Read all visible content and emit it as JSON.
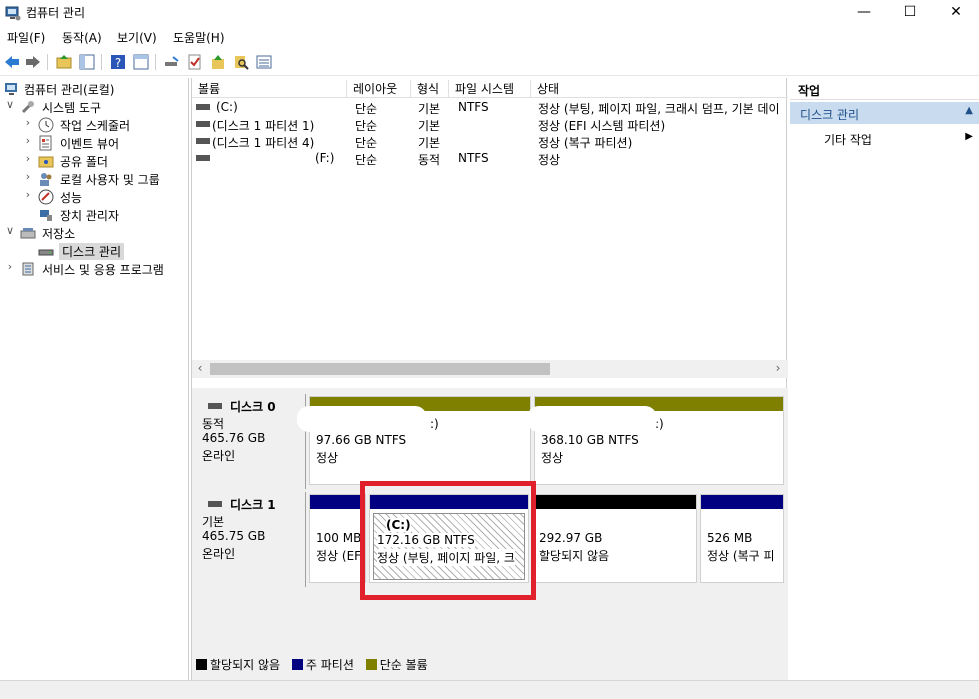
{
  "window": {
    "title": "컴퓨터 관리",
    "minimize": "—",
    "maximize": "☐",
    "close": "✕"
  },
  "menu": [
    "파일(F)",
    "동작(A)",
    "보기(V)",
    "도움말(H)"
  ],
  "tree": {
    "root": "컴퓨터 관리(로컬)",
    "system_tools": "시스템 도구",
    "task_scheduler": "작업 스케줄러",
    "event_viewer": "이벤트 뷰어",
    "shared_folders": "공유 폴더",
    "local_users": "로컬 사용자 및 그룹",
    "performance": "성능",
    "device_manager": "장치 관리자",
    "storage": "저장소",
    "disk_management": "디스크 관리",
    "services": "서비스 및 응용 프로그램"
  },
  "volume_table": {
    "columns": [
      "볼륨",
      "레이아웃",
      "형식",
      "파일 시스템",
      "상태"
    ],
    "rows": [
      {
        "volume": "(C:)",
        "layout": "단순",
        "type": "기본",
        "fs": "NTFS",
        "status": "정상 (부팅, 페이지 파일, 크래시 덤프, 기본 데이"
      },
      {
        "volume": "(디스크 1 파티션 1)",
        "layout": "단순",
        "type": "기본",
        "fs": "",
        "status": "정상 (EFI 시스템 파티션)"
      },
      {
        "volume": "(디스크 1 파티션 4)",
        "layout": "단순",
        "type": "기본",
        "fs": "",
        "status": "정상 (복구 파티션)"
      },
      {
        "volume": "(F:)",
        "layout": "단순",
        "type": "동적",
        "fs": "NTFS",
        "status": "정상"
      }
    ]
  },
  "disks": [
    {
      "name": "디스크 0",
      "type": "동적",
      "size": "465.76 GB",
      "state": "온라인",
      "partitions": [
        {
          "label": ":)",
          "size": "97.66 GB NTFS",
          "status": "정상",
          "color": "#808000"
        },
        {
          "label": ":)",
          "size": "368.10 GB NTFS",
          "status": "정상",
          "color": "#808000"
        }
      ]
    },
    {
      "name": "디스크 1",
      "type": "기본",
      "size": "465.75 GB",
      "state": "온라인",
      "partitions": [
        {
          "label": "",
          "size": "100 MB",
          "status": "정상 (EF",
          "color": "#000080"
        },
        {
          "label": "(C:)",
          "size": "172.16 GB NTFS",
          "status": "정상 (부팅, 페이지 파일, 크",
          "color": "#000080"
        },
        {
          "label": "",
          "size": "292.97 GB",
          "status": "할당되지 않음",
          "color": "#000000"
        },
        {
          "label": "",
          "size": "526 MB",
          "status": "정상 (복구 피",
          "color": "#000080"
        }
      ]
    }
  ],
  "legend": [
    {
      "label": "할당되지 않음",
      "color": "#000000"
    },
    {
      "label": "주 파티션",
      "color": "#000080"
    },
    {
      "label": "단순 볼륨",
      "color": "#808000"
    }
  ],
  "actions": {
    "header": "작업",
    "section": "디스크 관리",
    "more": "기타 작업"
  },
  "colors": {
    "selection": "#c9dbee",
    "highlight_box": "#e0202a"
  }
}
